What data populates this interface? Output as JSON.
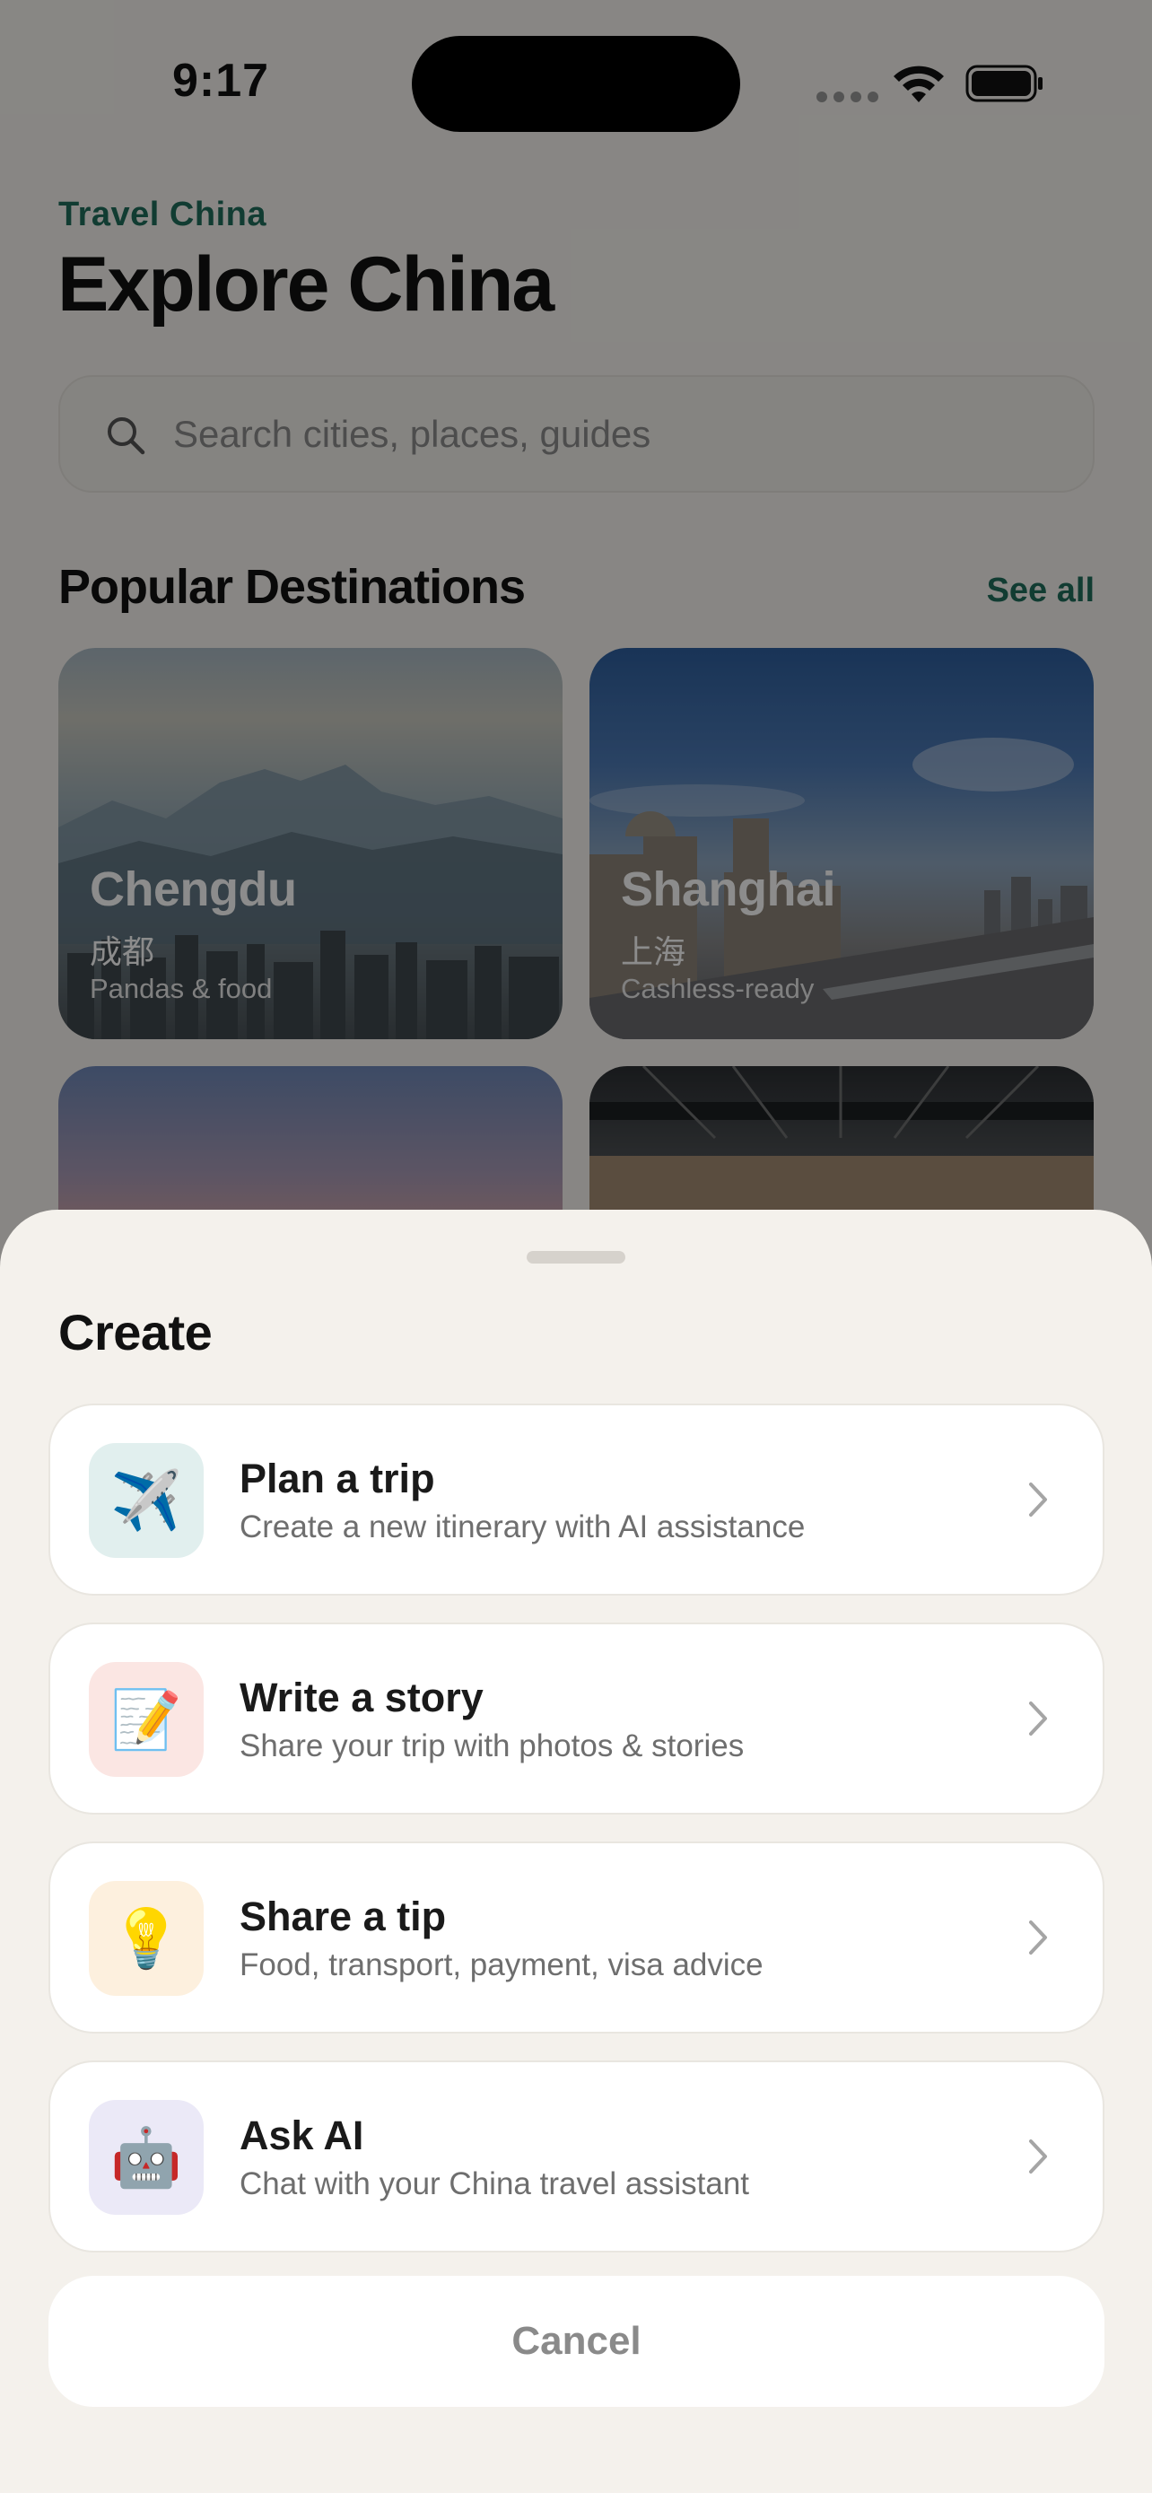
{
  "status_bar": {
    "time": "9:17"
  },
  "header": {
    "brand": "Travel China",
    "title": "Explore China"
  },
  "search": {
    "placeholder": "Search cities, places, guides",
    "icon": "search-icon"
  },
  "destinations": {
    "section_title": "Popular Destinations",
    "see_all_label": "See all",
    "cards": [
      {
        "name": "Chengdu",
        "name_cn": "成都",
        "tagline": "Pandas & food"
      },
      {
        "name": "Shanghai",
        "name_cn": "上海",
        "tagline": "Cashless-ready"
      },
      {
        "name": "",
        "name_cn": "",
        "tagline": ""
      },
      {
        "name": "",
        "name_cn": "",
        "tagline": ""
      }
    ]
  },
  "create_sheet": {
    "title": "Create",
    "options": [
      {
        "icon": "airplane-icon",
        "emoji": "✈️",
        "icon_bg": "#e1efee",
        "title": "Plan a trip",
        "subtitle": "Create a new itinerary with AI assistance"
      },
      {
        "icon": "memo-icon",
        "emoji": "📝",
        "icon_bg": "#fbe6e3",
        "title": "Write a story",
        "subtitle": "Share your trip with photos & stories"
      },
      {
        "icon": "lightbulb-icon",
        "emoji": "💡",
        "icon_bg": "#fdf0de",
        "title": "Share a tip",
        "subtitle": "Food, transport, payment, visa advice"
      },
      {
        "icon": "robot-icon",
        "emoji": "🤖",
        "icon_bg": "#ebe9f7",
        "title": "Ask AI",
        "subtitle": "Chat with your China travel assistant"
      }
    ],
    "cancel_label": "Cancel"
  },
  "colors": {
    "accent": "#1f6e5c",
    "sheet_bg": "#f4f1ec",
    "overlay": "rgba(0,0,0,0.45)"
  }
}
